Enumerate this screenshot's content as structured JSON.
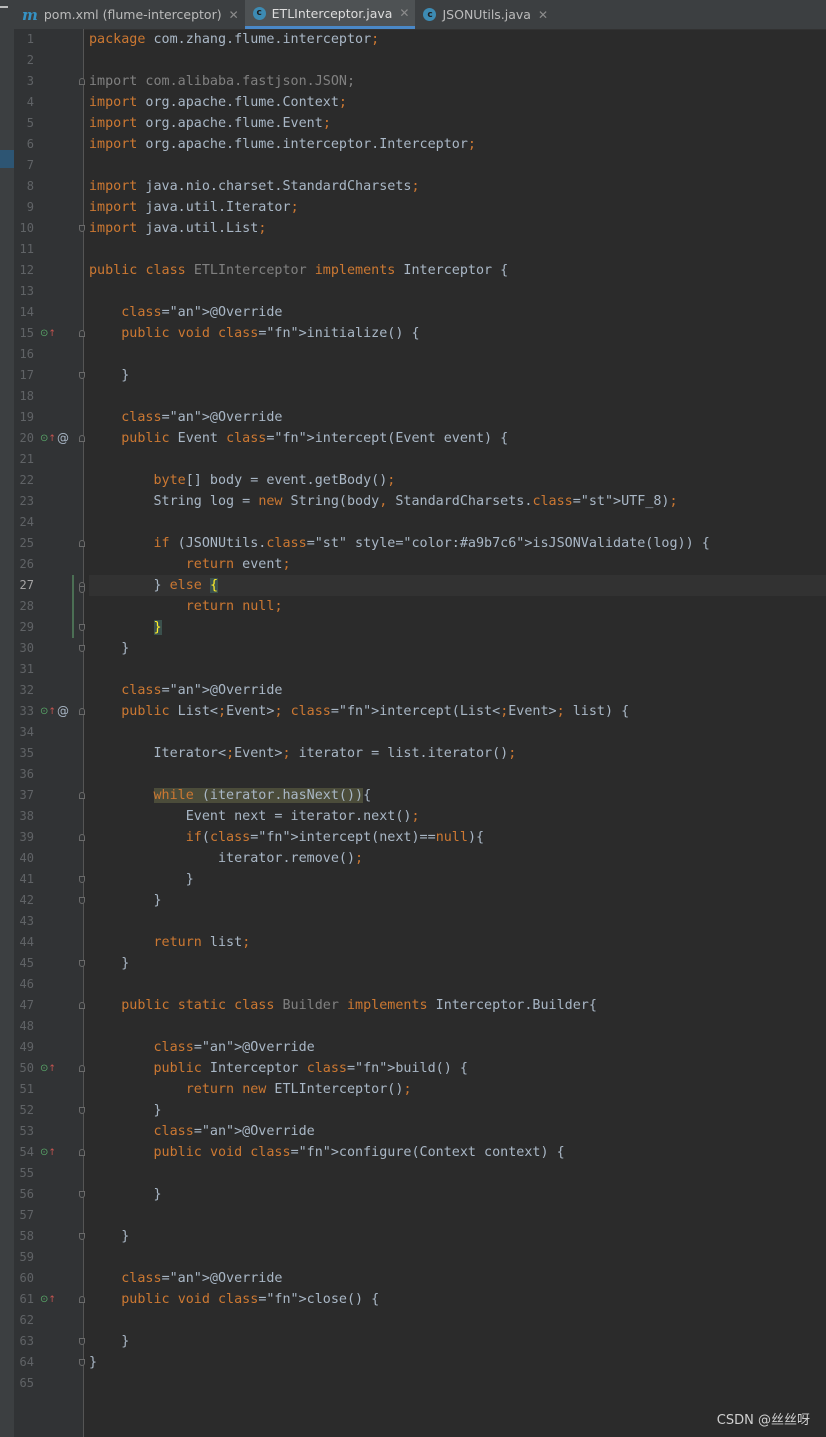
{
  "tabs": [
    {
      "label": "pom.xml (flume-interceptor)",
      "icon": "maven-icon",
      "icon_glyph": "m",
      "active": false
    },
    {
      "label": "ETLInterceptor.java",
      "icon": "java-class-icon",
      "icon_glyph": "c",
      "active": true
    },
    {
      "label": "JSONUtils.java",
      "icon": "java-class-icon",
      "icon_glyph": "c",
      "active": false
    }
  ],
  "tab_close_glyph": "✕",
  "current_line": 27,
  "line_count": 65,
  "code_lines": [
    "package com.zhang.flume.interceptor;",
    "",
    "import com.alibaba.fastjson.JSON;",
    "import org.apache.flume.Context;",
    "import org.apache.flume.Event;",
    "import org.apache.flume.interceptor.Interceptor;",
    "",
    "import java.nio.charset.StandardCharsets;",
    "import java.util.Iterator;",
    "import java.util.List;",
    "",
    "public class ETLInterceptor implements Interceptor {",
    "",
    "    @Override",
    "    public void initialize() {",
    "",
    "    }",
    "",
    "    @Override",
    "    public Event intercept(Event event) {",
    "",
    "        byte[] body = event.getBody();",
    "        String log = new String(body, StandardCharsets.UTF_8);",
    "",
    "        if (JSONUtils.isJSONValidate(log)) {",
    "            return event;",
    "        } else {",
    "            return null;",
    "        }",
    "    }",
    "",
    "    @Override",
    "    public List<Event> intercept(List<Event> list) {",
    "",
    "        Iterator<Event> iterator = list.iterator();",
    "",
    "        while (iterator.hasNext()){",
    "            Event next = iterator.next();",
    "            if(intercept(next)==null){",
    "                iterator.remove();",
    "            }",
    "        }",
    "",
    "        return list;",
    "    }",
    "",
    "    public static class Builder implements Interceptor.Builder{",
    "",
    "        @Override",
    "        public Interceptor build() {",
    "            return new ETLInterceptor();",
    "        }",
    "        @Override",
    "        public void configure(Context context) {",
    "",
    "        }",
    "",
    "    }",
    "",
    "    @Override",
    "    public void close() {",
    "",
    "    }",
    "}",
    ""
  ],
  "gutter_markers": [
    {
      "line": 15,
      "type": "override"
    },
    {
      "line": 20,
      "type": "override",
      "at": true
    },
    {
      "line": 33,
      "type": "override",
      "at": true
    },
    {
      "line": 50,
      "type": "override"
    },
    {
      "line": 54,
      "type": "override"
    },
    {
      "line": 61,
      "type": "override"
    }
  ],
  "fold_markers": [
    {
      "line": 3,
      "kind": "s"
    },
    {
      "line": 10,
      "kind": "e"
    },
    {
      "line": 15,
      "kind": "s"
    },
    {
      "line": 17,
      "kind": "e"
    },
    {
      "line": 20,
      "kind": "s"
    },
    {
      "line": 25,
      "kind": "s"
    },
    {
      "line": 27,
      "kind": "s"
    },
    {
      "line": 27,
      "kind": "e"
    },
    {
      "line": 29,
      "kind": "e"
    },
    {
      "line": 30,
      "kind": "e"
    },
    {
      "line": 33,
      "kind": "s"
    },
    {
      "line": 37,
      "kind": "s"
    },
    {
      "line": 39,
      "kind": "s"
    },
    {
      "line": 41,
      "kind": "e"
    },
    {
      "line": 42,
      "kind": "e"
    },
    {
      "line": 45,
      "kind": "e"
    },
    {
      "line": 47,
      "kind": "s"
    },
    {
      "line": 50,
      "kind": "s"
    },
    {
      "line": 52,
      "kind": "e"
    },
    {
      "line": 54,
      "kind": "s"
    },
    {
      "line": 56,
      "kind": "e"
    },
    {
      "line": 58,
      "kind": "e"
    },
    {
      "line": 61,
      "kind": "s"
    },
    {
      "line": 63,
      "kind": "e"
    },
    {
      "line": 64,
      "kind": "e"
    }
  ],
  "gutter_glyphs": {
    "override": "⊙",
    "up": "↑",
    "at": "@"
  },
  "watermark": "CSDN @丝丝呀",
  "colors": {
    "background": "#2b2b2b",
    "keyword": "#cc7832",
    "annotation": "#bbb529",
    "method": "#ffc66d",
    "static_field": "#9876aa",
    "text": "#a9b7c6",
    "line_number": "#606366",
    "tab_active_underline": "#4a88c7"
  }
}
